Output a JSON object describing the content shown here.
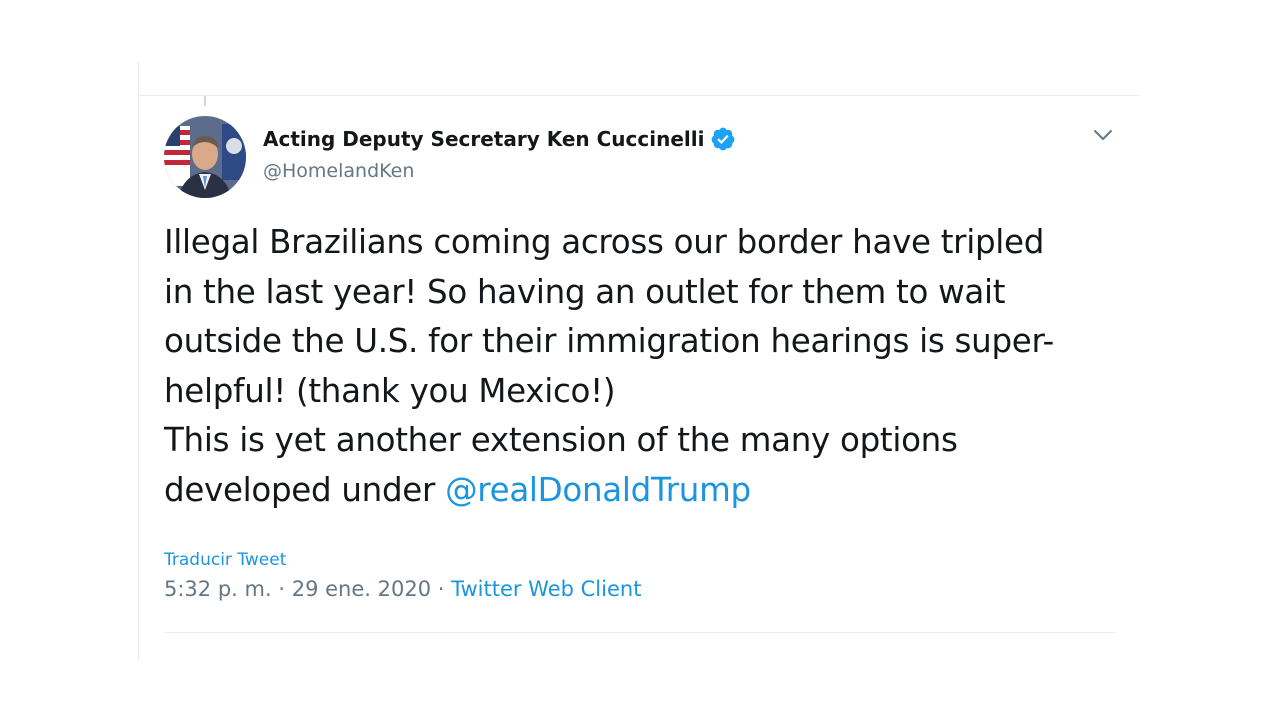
{
  "tweet": {
    "author_name": "Acting Deputy Secretary Ken Cuccinelli",
    "handle": "@HomelandKen",
    "verified": true,
    "body_lines": [
      "Illegal Brazilians coming across our border have tripled",
      "in the last year! So having an outlet for them to wait",
      "outside the U.S. for their immigration hearings is super-",
      "helpful! (thank you Mexico!)",
      "This is yet another extension of the many options"
    ],
    "last_line_prefix": "developed under ",
    "mention": "@realDonaldTrump",
    "translate_label": "Traducir Tweet",
    "time": "5:32 p. m.",
    "date": "29 ene. 2020",
    "separator": "·",
    "source": "Twitter Web Client"
  },
  "icons": {
    "verified": "verified-badge-icon",
    "caret": "chevron-down-icon"
  },
  "colors": {
    "link": "#1b95e0",
    "text": "#14171a",
    "secondary": "#657786",
    "border": "#e6ecf0"
  }
}
